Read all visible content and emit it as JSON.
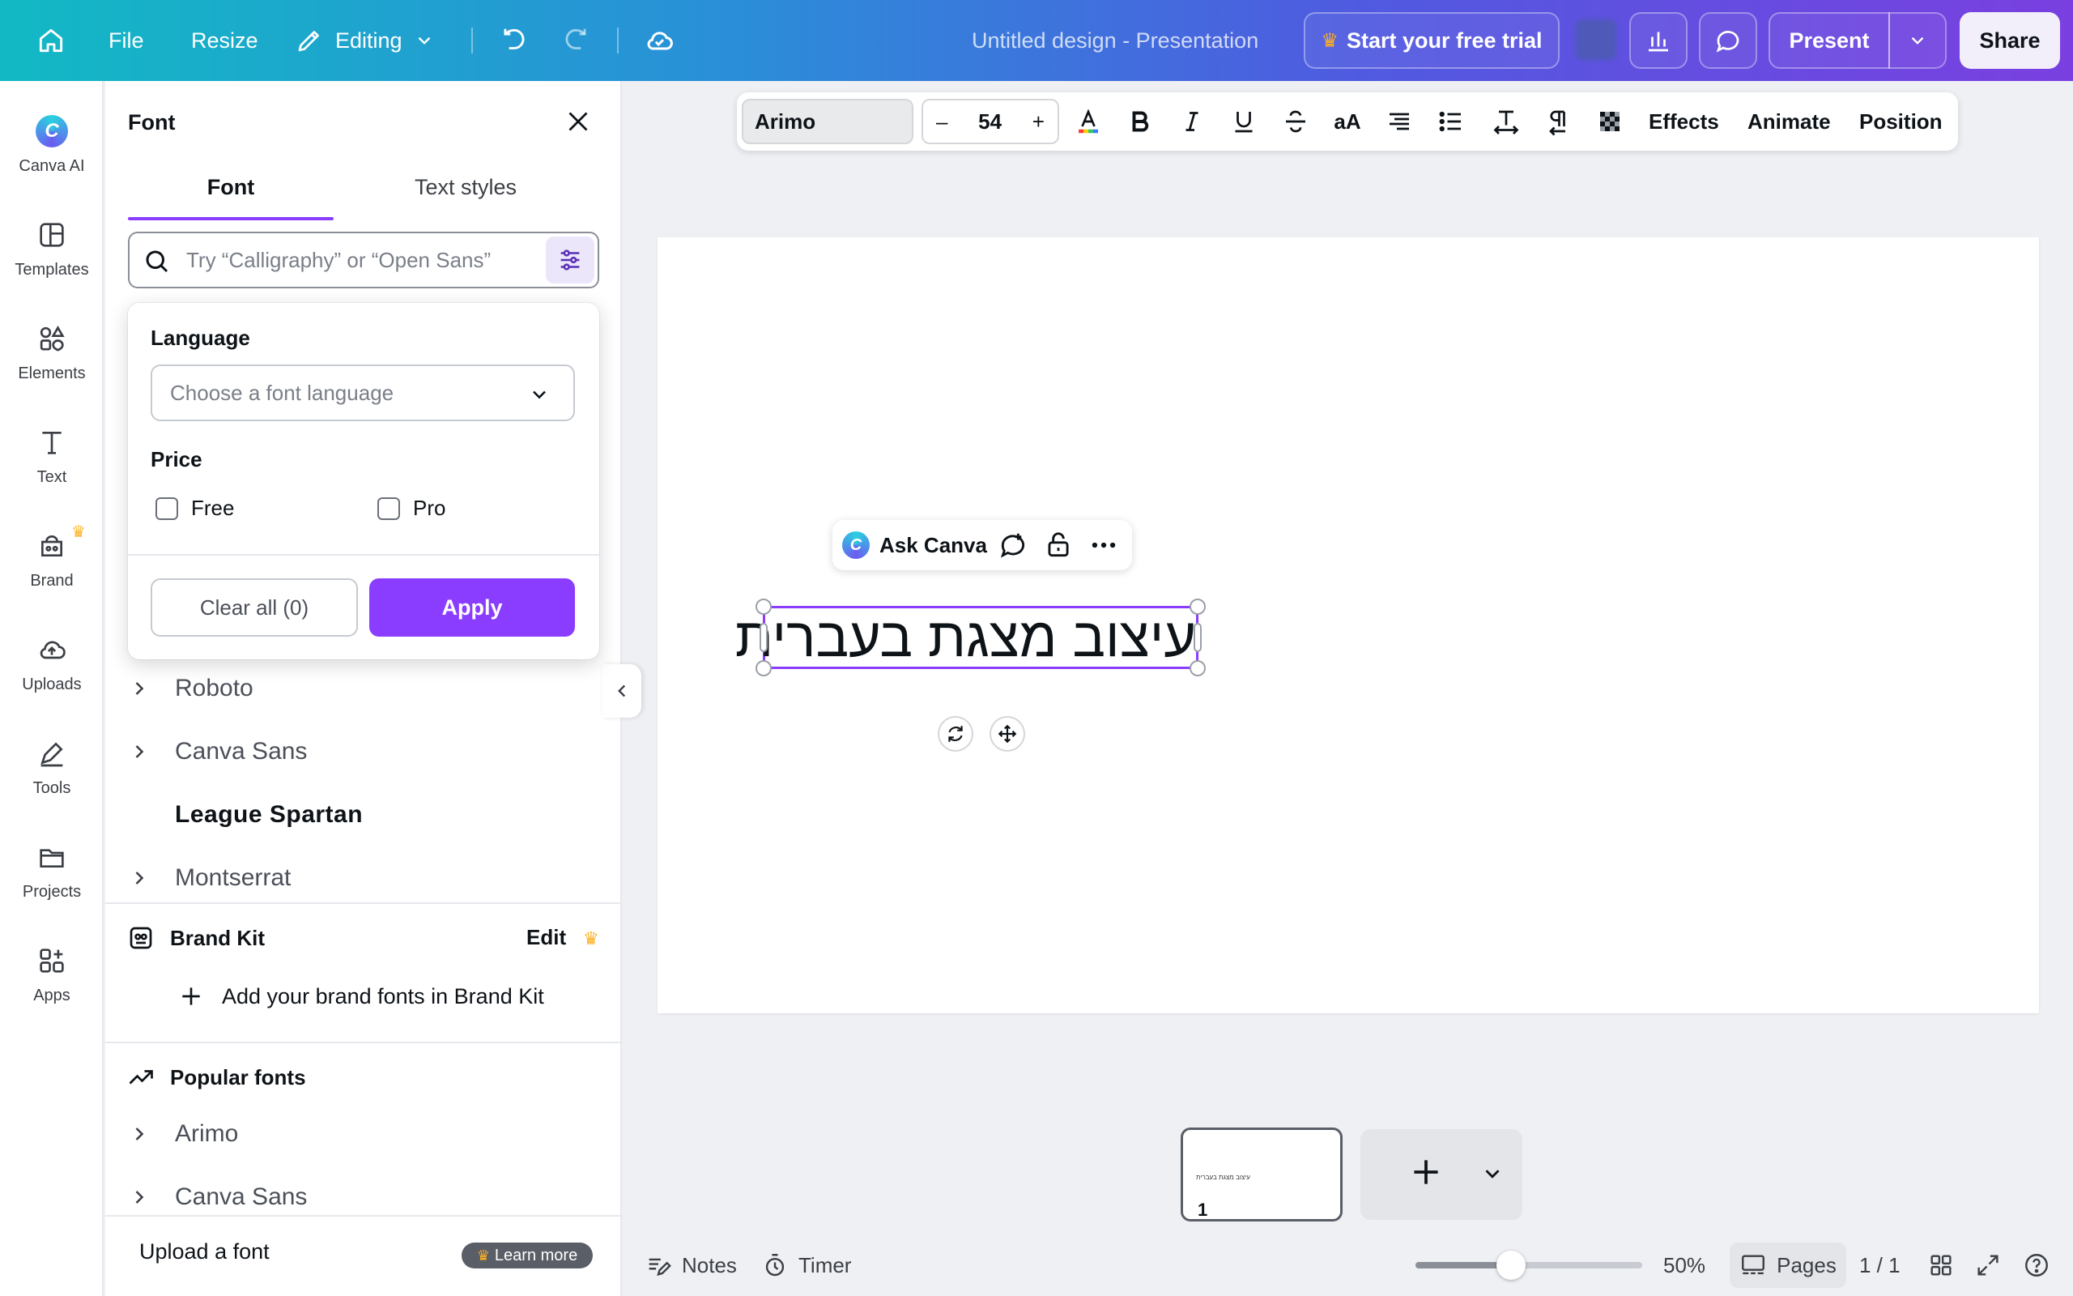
{
  "topbar": {
    "file": "File",
    "resize": "Resize",
    "editing": "Editing",
    "doc_title": "Untitled design - Presentation",
    "trial": "Start your free trial",
    "present": "Present",
    "share": "Share"
  },
  "rail": [
    {
      "label": "Canva AI",
      "icon": "canva-ai-icon"
    },
    {
      "label": "Templates",
      "icon": "templates-icon"
    },
    {
      "label": "Elements",
      "icon": "elements-icon"
    },
    {
      "label": "Text",
      "icon": "text-icon"
    },
    {
      "label": "Brand",
      "icon": "brand-icon"
    },
    {
      "label": "Uploads",
      "icon": "uploads-icon"
    },
    {
      "label": "Tools",
      "icon": "tools-icon"
    },
    {
      "label": "Projects",
      "icon": "projects-icon"
    },
    {
      "label": "Apps",
      "icon": "apps-icon"
    }
  ],
  "panel": {
    "title": "Font",
    "tabs": [
      "Font",
      "Text styles"
    ],
    "search_placeholder": "Try “Calligraphy” or “Open Sans”",
    "doc_fonts": [
      {
        "name": "Roboto",
        "expandable": true
      },
      {
        "name": "Canva Sans",
        "expandable": true
      },
      {
        "name": "League Spartan",
        "expandable": false
      },
      {
        "name": "Montserrat",
        "expandable": true
      }
    ],
    "brand_kit": {
      "title": "Brand Kit",
      "edit": "Edit",
      "add": "Add your brand fonts in Brand Kit"
    },
    "popular": {
      "title": "Popular fonts",
      "fonts": [
        "Arimo",
        "Canva Sans"
      ]
    },
    "upload_font": "Upload a font",
    "learn_more": "Learn more"
  },
  "filter": {
    "language_label": "Language",
    "language_placeholder": "Choose a font language",
    "price_label": "Price",
    "free": "Free",
    "pro": "Pro",
    "clear": "Clear all (0)",
    "apply": "Apply"
  },
  "text_toolbar": {
    "font": "Arimo",
    "size": "54",
    "minus": "–",
    "plus": "+",
    "effects": "Effects",
    "animate": "Animate",
    "position": "Position",
    "case_label": "aA"
  },
  "canvas": {
    "ask_canva": "Ask Canva",
    "text": "עיצוב מצגת בעברית"
  },
  "pages": {
    "thumb_number": "1"
  },
  "bottom": {
    "notes": "Notes",
    "timer": "Timer",
    "zoom": "50%",
    "zoom_fraction": 0.42,
    "pages": "Pages",
    "page_count": "1 / 1"
  },
  "colors": {
    "accent": "#8b3dff",
    "crown": "#ffb020"
  }
}
